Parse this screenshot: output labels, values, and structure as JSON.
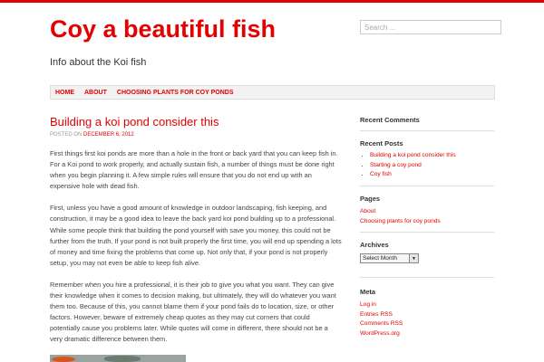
{
  "site": {
    "title": "Coy a beautiful fish",
    "description": "Info about the Koi fish",
    "accent_color": "#e40000"
  },
  "search": {
    "placeholder": "Search ..."
  },
  "nav": {
    "items": [
      {
        "label": "HOME"
      },
      {
        "label": "ABOUT"
      },
      {
        "label": "CHOOSING PLANTS FOR COY PONDS"
      }
    ]
  },
  "post": {
    "title": "Building a koi pond consider this",
    "posted_on_label": "POSTED ON",
    "date": "DECEMBER 6, 2012",
    "paragraphs": [
      "First things first  koi  ponds are more than a hole in the front or back yard that you can keep fish in. For a Koi pond to work properly, and actually sustain fish, a number of  things must be done right when you begin planning it. A few simple rules will ensure that you do not end up with an expensive hole with dead fish.",
      "First, unless you have a good amount of knowledge in outdoor landscaping, fish keeping, and construction, it may be a good idea to leave the  back yard koi pond building up to a professional. While some people think that building the pond yourself with save you money, this could not be further from the truth. If your pond is not built properly the first time, you will end up spending a lots of money  and time fixing the problems that come up. Not only that, if your pond is not properly setup, you may not even be able to keep fish alive.",
      "Remember when you hire a professional, it is their job to give you what you want. They can give their knowledge when it comes to decision making, but ultimately, they will do whatever you want them too. Because of this, you cannot blame them if your pond fails do to location, size, or other factors. However, beware of extremely cheap quotes as they may cut corners that could potentially cause you problems later. While quotes will come in different, there should not be a very dramatic difference between them."
    ]
  },
  "sidebar": {
    "recent_comments": {
      "title": "Recent Comments"
    },
    "recent_posts": {
      "title": "Recent Posts",
      "items": [
        {
          "label": "Building a koi pond consider this"
        },
        {
          "label": "Starting a coy pond"
        },
        {
          "label": "Coy fish"
        }
      ]
    },
    "pages": {
      "title": "Pages",
      "items": [
        {
          "label": "About"
        },
        {
          "label": "Choosing plants for coy ponds"
        }
      ]
    },
    "archives": {
      "title": "Archives",
      "select_value": "Select Month"
    },
    "meta": {
      "title": "Meta",
      "items": [
        {
          "label": "Log in"
        },
        {
          "label": "Entries RSS"
        },
        {
          "label": "Comments RSS"
        },
        {
          "label": "WordPress.org"
        }
      ]
    }
  }
}
